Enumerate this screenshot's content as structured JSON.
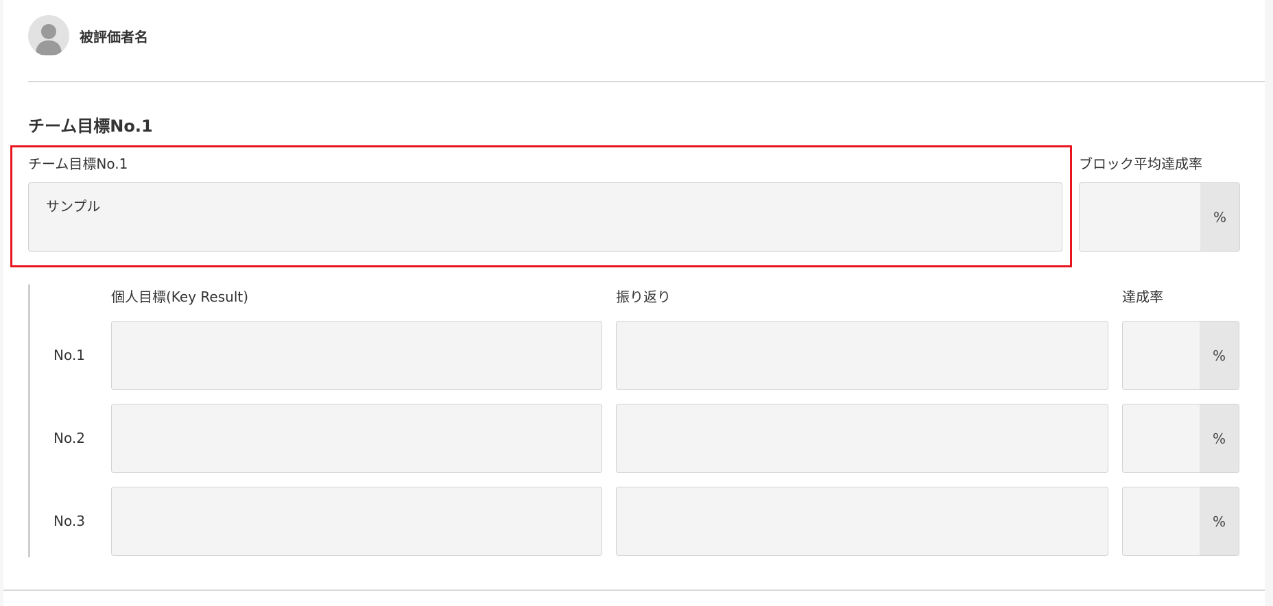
{
  "evaluatee": {
    "name": "被評価者名"
  },
  "section": {
    "title": "チーム目標No.1"
  },
  "team_goal": {
    "label": "チーム目標No.1",
    "value": "サンプル",
    "block_avg_label": "ブロック平均達成率",
    "block_avg_value": "",
    "percent_unit": "%"
  },
  "key_results": {
    "headers": {
      "key_result": "個人目標(Key Result)",
      "reflection": "振り返り",
      "achievement": "達成率"
    },
    "rows": [
      {
        "label": "No.1",
        "key_result": "",
        "reflection": "",
        "achievement": "",
        "unit": "%"
      },
      {
        "label": "No.2",
        "key_result": "",
        "reflection": "",
        "achievement": "",
        "unit": "%"
      },
      {
        "label": "No.3",
        "key_result": "",
        "reflection": "",
        "achievement": "",
        "unit": "%"
      }
    ]
  },
  "icons": {
    "avatar": "user-avatar-icon"
  },
  "colors": {
    "highlight": "#e8141e",
    "field_bg": "#f4f4f4",
    "unit_bg": "#e6e6e6"
  }
}
